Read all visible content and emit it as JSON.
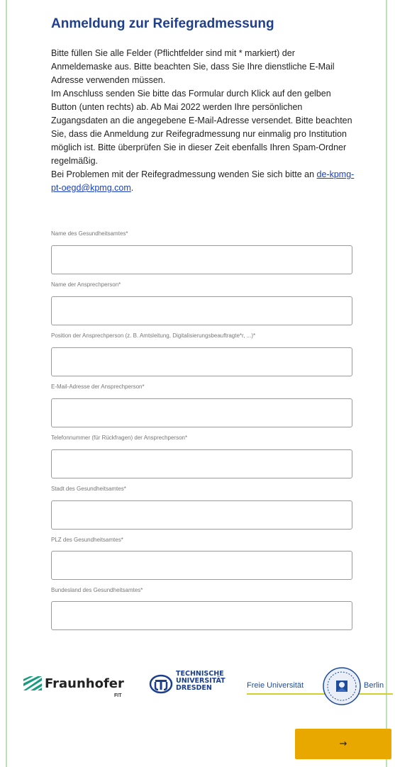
{
  "page": {
    "title": "Anmeldung zur Reifegradmessung",
    "intro_paragraphs": [
      "Bitte füllen Sie alle Felder (Pflichtfelder sind mit * markiert) der Anmeldemaske aus. Bitte beachten Sie, dass Sie Ihre dienstliche E-Mail Adresse verwenden müssen.",
      "Im Anschluss senden Sie bitte das Formular durch Klick auf den gelben Button (unten rechts) ab. Ab Mai 2022 werden Ihre persönlichen Zugangsdaten an die angegebene E-Mail-Adresse versendet. Bitte beachten Sie, dass die Anmeldung zur Reifegradmessung nur einmalig pro Institution möglich ist. Bitte überprüfen Sie in dieser Zeit ebenfalls Ihren Spam-Ordner regelmäßig."
    ],
    "contact_prefix": "Bei Problemen mit der Reifegradmessung wenden Sie sich bitte an ",
    "contact_email": "de-kpmg-pt-oegd@kpmg.com",
    "contact_suffix": "."
  },
  "form": {
    "fields": [
      {
        "label": "Name des Gesundheitsamtes*",
        "value": ""
      },
      {
        "label": "Name der Ansprechperson*",
        "value": ""
      },
      {
        "label": "Position der Ansprechperson (z. B. Amtsleitung, Digitalisierungsbeauftragte*r, ...)*",
        "value": ""
      },
      {
        "label": "E-Mail-Adresse der Ansprechperson*",
        "value": ""
      },
      {
        "label": "Telefonnummer (für Rückfragen) der Ansprechperson*",
        "value": ""
      },
      {
        "label": "Stadt des Gesundheitsamtes*",
        "value": ""
      },
      {
        "label": "PLZ des Gesundheitsamtes*",
        "value": ""
      },
      {
        "label": "Bundesland des Gesundheitsamtes*",
        "value": ""
      }
    ]
  },
  "logos": {
    "fraunhofer": {
      "name": "Fraunhofer",
      "sub": "FIT",
      "color": "#179c7d"
    },
    "tud": {
      "line1": "TECHNISCHE",
      "line2": "UNIVERSITÄT",
      "line3": "DRESDEN",
      "color": "#1b3f8c"
    },
    "fu": {
      "left": "Freie Universität",
      "right": "Berlin",
      "color": "#1e4b9a"
    }
  },
  "next_button": {
    "label": "→",
    "color": "#e8a800"
  }
}
